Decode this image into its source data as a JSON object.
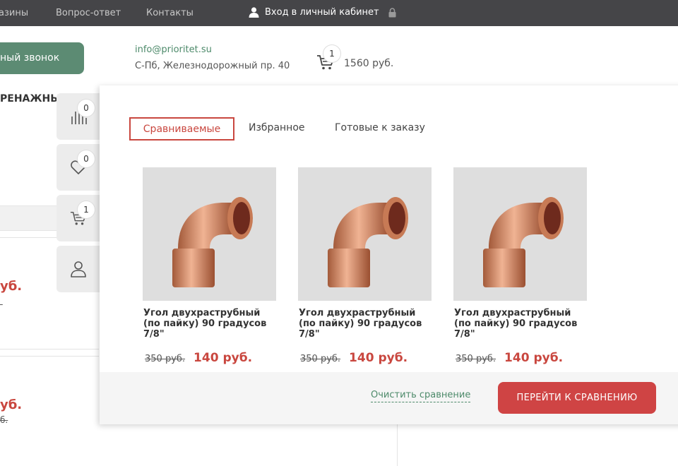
{
  "topbar": {
    "nav": [
      "азины",
      "Вопрос-ответ",
      "Контакты"
    ],
    "login_label": "Вход в личный кабинет",
    "login_icon": "user-icon",
    "lock_icon": "lock-icon"
  },
  "header": {
    "callback_label": "ный звонок",
    "email": "info@prioritet.su",
    "address": "С-Пб, Железнодорожный пр. 40",
    "cart_count": "1",
    "cart_total": "1560 руб."
  },
  "background": {
    "category": "РЕНАЖНЫЕ",
    "price1": "уб.",
    "price2": "уб.",
    "old2": "б."
  },
  "sidebar": {
    "compare_count": "0",
    "favorites_count": "0",
    "cart_count": "1"
  },
  "panel": {
    "tabs": [
      "Сравниваемые",
      "Избранное",
      "Готовые к заказу"
    ],
    "products": [
      {
        "name": "Угол двухраструбный (по пайку) 90 градусов 7/8\"",
        "old_price": "350 руб.",
        "price": "140 руб."
      },
      {
        "name": "Угол двухраструбный (по пайку) 90 градусов 7/8\"",
        "old_price": "350 руб.",
        "price": "140 руб."
      },
      {
        "name": "Угол двухраструбный (по пайку) 90 градусов 7/8\"",
        "old_price": "350 руб.",
        "price": "140 руб."
      }
    ],
    "clear_label": "Очистить сравнение",
    "go_label": "ПЕРЕЙТИ К СРАВНЕНИЮ"
  },
  "colors": {
    "accent_red": "#c9473f",
    "accent_green": "#5c8b73",
    "topbar": "#454548"
  }
}
